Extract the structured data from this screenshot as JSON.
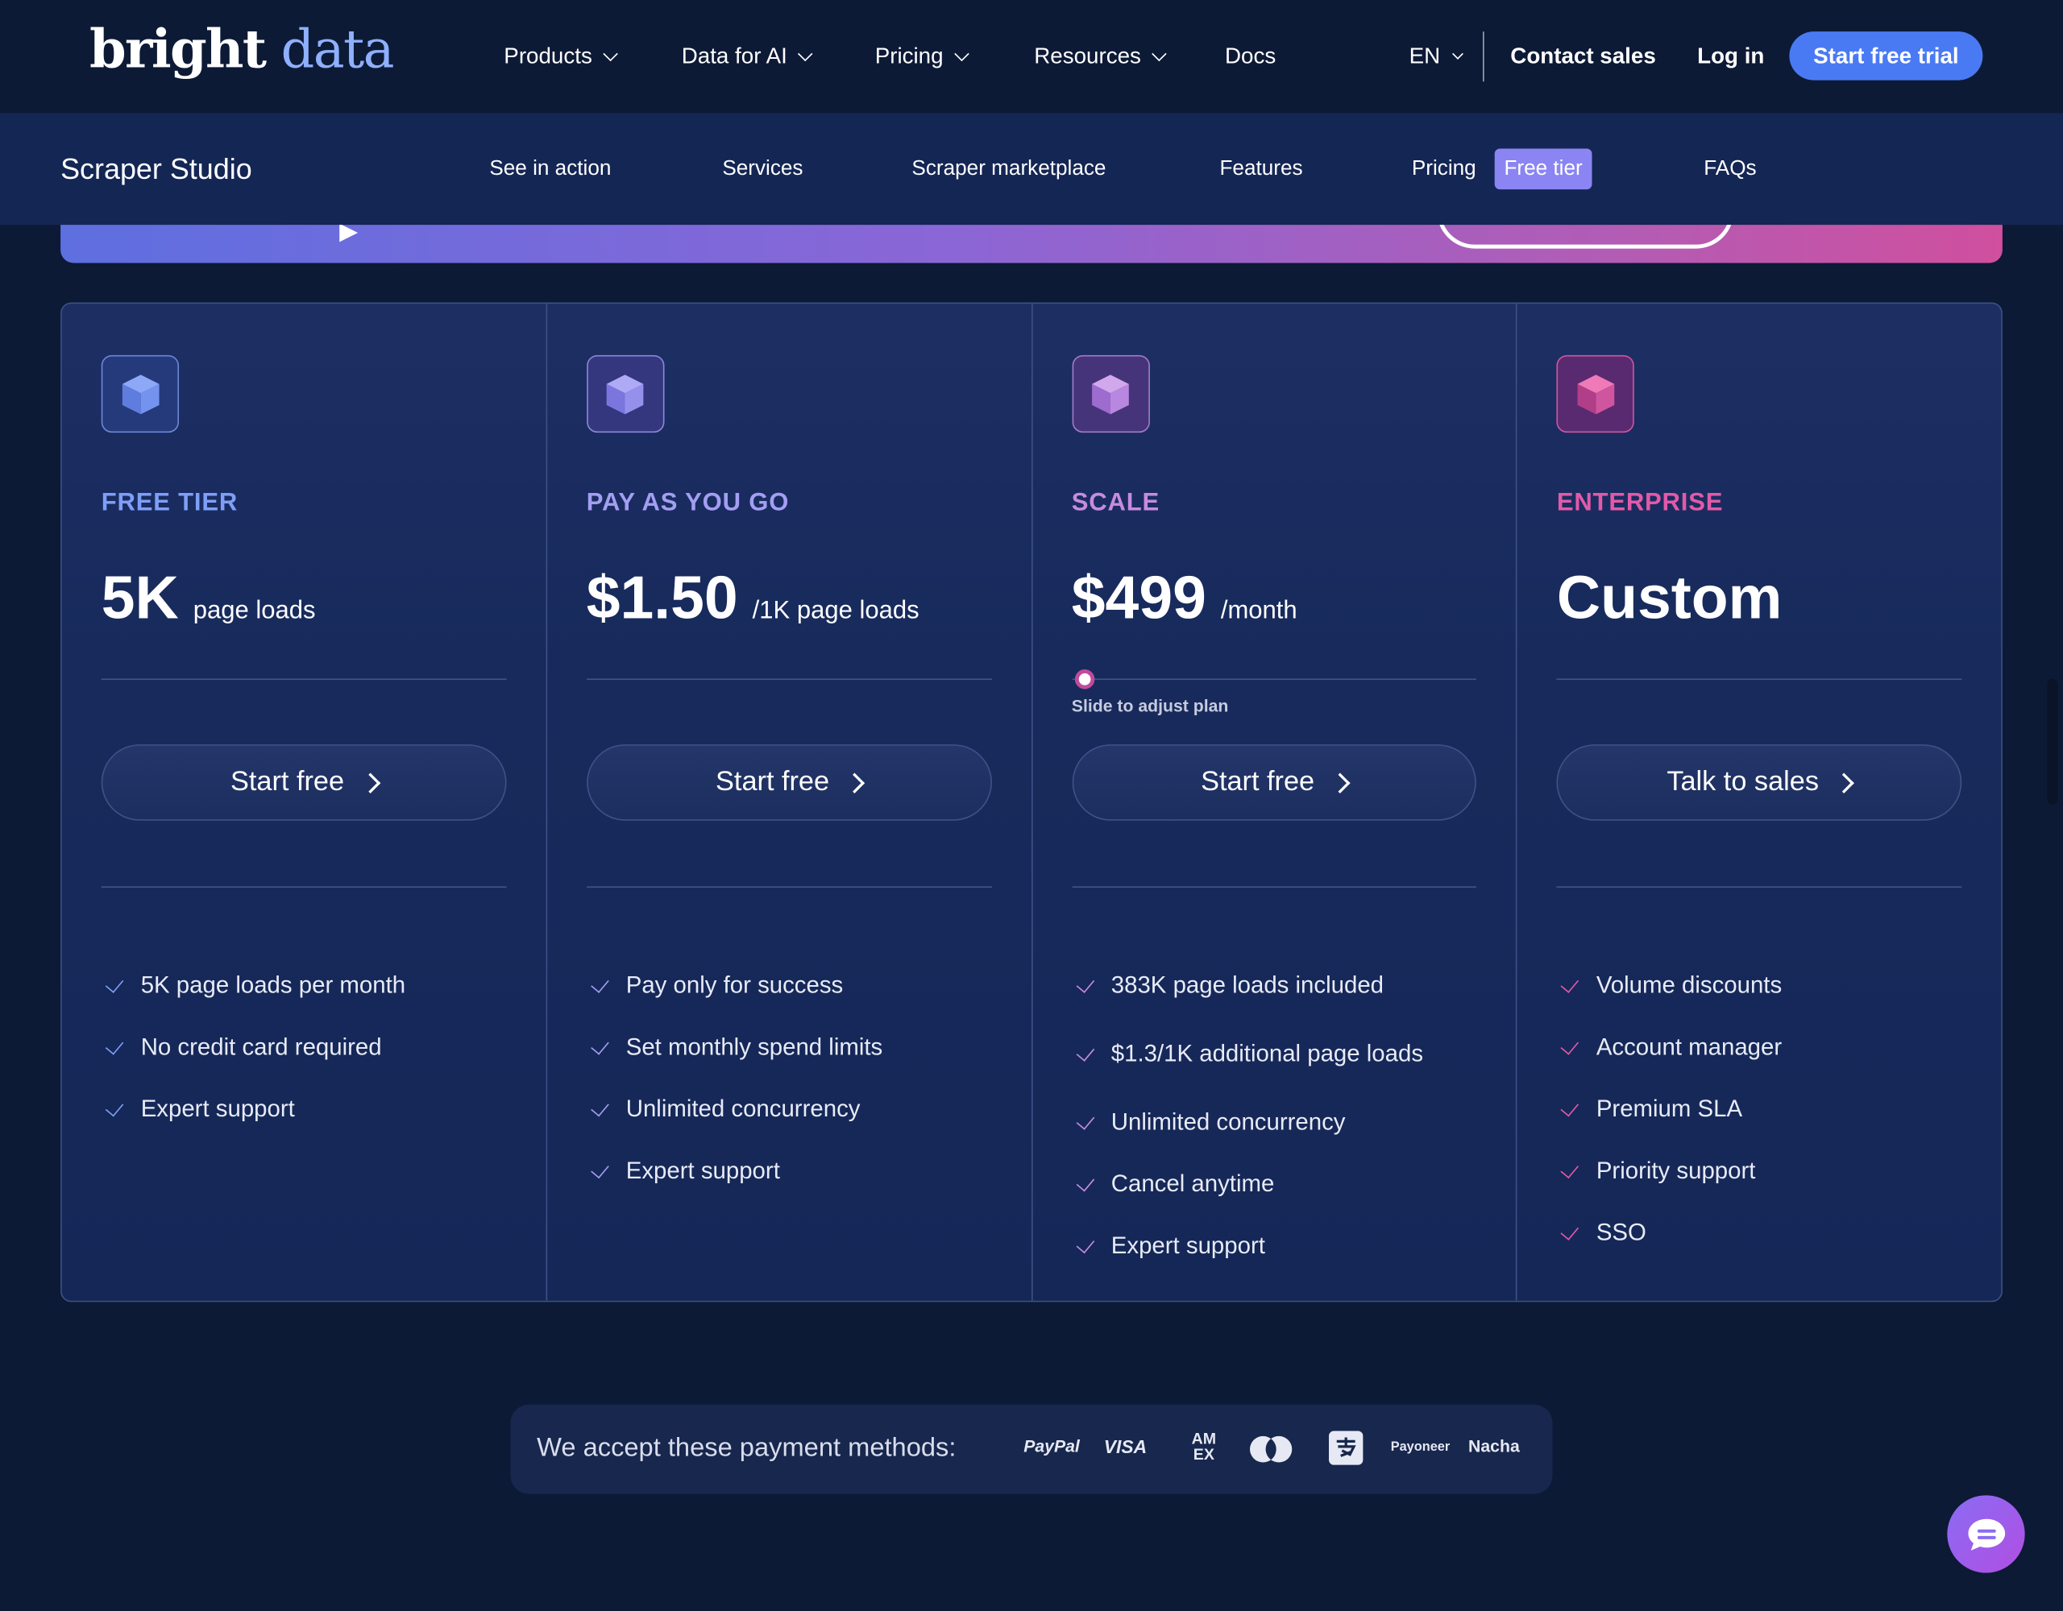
{
  "topnav": {
    "logo_part1": "bright",
    "logo_part2": "data",
    "items": [
      {
        "label": "Products"
      },
      {
        "label": "Data for AI"
      },
      {
        "label": "Pricing"
      },
      {
        "label": "Resources"
      },
      {
        "label": "Docs"
      }
    ],
    "language": "EN",
    "contact_sales": "Contact sales",
    "login": "Log in",
    "cta": "Start free trial"
  },
  "subnav": {
    "title": "Scraper Studio",
    "links": [
      "See in action",
      "Services",
      "Scraper marketplace",
      "Features",
      "Pricing",
      "FAQs"
    ],
    "free_tier_tag": "Free tier"
  },
  "plans": [
    {
      "name": "FREE TIER",
      "accent": "#7f9ef7",
      "price": "5K",
      "unit": "page loads",
      "button": "Start free",
      "features": [
        "5K page loads per month",
        "No credit card required",
        "Expert support"
      ]
    },
    {
      "name": "PAY AS YOU GO",
      "accent": "#a49ef3",
      "price": "$1.50",
      "unit": "/1K page loads",
      "button": "Start free",
      "features": [
        "Pay only for success",
        "Set monthly spend limits",
        "Unlimited concurrency",
        "Expert support"
      ]
    },
    {
      "name": "SCALE",
      "accent": "#c78be0",
      "price": "$499",
      "unit": "/month",
      "slider_note": "Slide to adjust plan",
      "slider_level": 0,
      "button": "Start free",
      "features": [
        "383K page loads included",
        "$1.3/1K additional page loads",
        "Unlimited concurrency",
        "Cancel anytime",
        "Expert support"
      ]
    },
    {
      "name": "ENTERPRISE",
      "accent": "#e25aa8",
      "price": "Custom",
      "unit": "",
      "button": "Talk to sales",
      "features": [
        "Volume discounts",
        "Account manager",
        "Premium SLA",
        "Priority support",
        "SSO"
      ]
    }
  ],
  "payments": {
    "label": "We accept these payment methods:",
    "methods": [
      "PayPal",
      "VISA",
      "AMEX",
      "Mastercard",
      "Alipay",
      "Payoneer",
      "Nacha"
    ],
    "text_logos": {
      "paypal": "PayPal",
      "visa": "VISA",
      "amex": "AM EX",
      "payoneer": "Payoneer",
      "nacha": "Nacha"
    }
  },
  "icons": [
    "chevron-down-icon",
    "cube-icon",
    "check-icon",
    "arrow-right-icon",
    "chat-icon",
    "play-icon"
  ]
}
